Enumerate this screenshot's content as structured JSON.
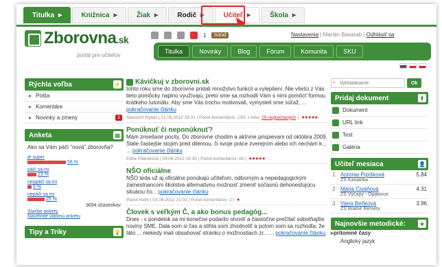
{
  "top_tabs": [
    {
      "label": "Titulka"
    },
    {
      "label": "Knižnica"
    },
    {
      "label": "Žiak"
    },
    {
      "label": "Rodič"
    },
    {
      "label": "Učiteľ"
    },
    {
      "label": "Škola"
    }
  ],
  "header": {
    "logo_main": "Zborovna",
    "logo_suffix": ".sk",
    "tagline": "portál pre učiteľov",
    "count": "1",
    "sutaz": "Súťaž",
    "nastavenia": "Nastavenia",
    "user": "Marián Basarab",
    "logout": "Odhlásiť sa",
    "sep": "|"
  },
  "nav": [
    "Titulka",
    "Novinky",
    "Blog",
    "Fórum",
    "Komunita",
    "SKU"
  ],
  "left": {
    "quick_title": "Rýchla voľba",
    "quick_items": [
      {
        "label": "Pošta"
      },
      {
        "label": "Komentáre"
      },
      {
        "label": "Novinky a zmeny",
        "badge": "1"
      }
    ],
    "anketa_title": "Anketa",
    "anketa_question": "Ako sa Vám páči \"nová\" zborovňa?",
    "options": [
      {
        "label": "je super",
        "pct": "56 %",
        "value": 56
      },
      {
        "label": "páči sa mi",
        "pct": "13 %",
        "value": 13
      },
      {
        "label": "neopáči sa mi",
        "pct": "6 %",
        "value": 6
      },
      {
        "label": "nepáči sa mi",
        "pct": "25 %",
        "value": 25
      }
    ],
    "participants": "3694 účastníkov",
    "older_polls": "Staršie ankety",
    "suggest_poll": "Navrhnite vlastnú anketu",
    "tips_title": "Tipy a Triky"
  },
  "articles": [
    {
      "title": "Kávičkuj v zborovni.sk",
      "text": "tohto roku sme do zborovne pridali množstvo funkcií a vylepšení. Nie všetci z Vás tieto pomôcky naplno využívajú, preto sme sa rozhodli Vám s nimi pomôcť formou krátkeho tutoriálu. Aby sme Vás trochu motivovali, vymysleli sme súťaž, ...",
      "more": "pokračovanie článku",
      "meta": "Slavomír Rybár | 21.05.2012 16:31 | Počet komentárov: 133, z toho",
      "meta_hl": "29 neprečítaných",
      "sep": "|",
      "stars": "★★★★★"
    },
    {
      "title": "Ponúknuť či neponúknuť?",
      "text": "Mám zmiešané pocity. Do zborovne chodím a aktívne prispievam od októbra 2009. Stále častejšie stojím pred dilemou, či svoje práce zverejním alebo ich nechám k... ...",
      "more": "pokračovanie článku",
      "meta": "Edita Pálenková | 04.06.2012 16:30 | Počet komentárov: 60 |",
      "stars": "★★★★★"
    },
    {
      "title": "NŠO oficiálne",
      "text": "NŠO teda už aj oficiálne ponúkajú učiteľom, odborným a nepedagogickým zamestnancom školstva alternatívnu možnosť zmeniť súčasnú dehonestujúcu situáciu čo...",
      "more": "pokračovanie článku",
      "meta": "Pavol Hulík | 03.06.2012 21:02 | Počet komentárov: 1 |",
      "stars": "★"
    },
    {
      "title": "Človek s veľkým Č, a ako bonus pedagóg...",
      "text": "Dnes - v pondelok sa mi konečne podarilo otvoriť a čiastočne prečítať sobotňajšie noviny SME. Dala som si čas a stihla som zhodnotiť a potom som sa rozhodla, že táto ... niekedy mali obsahovať stránku o možnostiach zr... ...",
      "more": "pokračovanie článku"
    }
  ],
  "right": {
    "search_placeholder": "Vyhľadávanie",
    "ok": "Ok",
    "add_title": "Pridaj dokument",
    "add_items": [
      "Dokument",
      "URL link",
      "Test",
      "Galéria"
    ],
    "teachers_title": "Učiteľ mesiaca",
    "teachers": [
      {
        "rank": "1.",
        "name": "Antónia Pipíšková",
        "school": "ZŠ Kanianka",
        "score": "5.84"
      },
      {
        "rank": "2.",
        "name": "Mária Civáňová",
        "school": "ZŠ Výčapy - Opatovce",
        "score": "4.31"
      },
      {
        "rank": "3.",
        "name": "Viera Beňková",
        "school": "ZŠ Bratné Remety",
        "score": "3.96"
      }
    ],
    "new_title": "Najnovšie metodické:",
    "new_items": [
      {
        "label": "prítomné časy"
      },
      {
        "label": "Anglický jazyk"
      }
    ]
  }
}
